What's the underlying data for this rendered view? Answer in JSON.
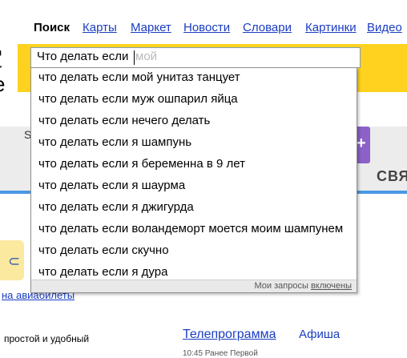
{
  "nav": {
    "items": [
      {
        "label": "Поиск",
        "active": true
      },
      {
        "label": "Карты"
      },
      {
        "label": "Маркет"
      },
      {
        "label": "Новости"
      },
      {
        "label": "Словари"
      },
      {
        "label": "Картинки"
      },
      {
        "label": "Видео"
      }
    ]
  },
  "logo": {
    "letter_c": "с",
    "letter_e": "е"
  },
  "search": {
    "typed_value": "Что делать если",
    "ghost_completion": "мой"
  },
  "suggestions": [
    "что делать если мой унитаз танцует",
    "что делать если муж ошпарил яйца",
    "что делать если нечего делать",
    "что делать если я шампунь",
    "что делать если я беременна в 9 лет",
    "что делать если я шаурма",
    "что делать если я джигурда",
    "что делать если воландеморт моется моим шампунем",
    "что делать если скучно",
    "что делать если я дура"
  ],
  "dropdown_footer": {
    "label": "Мои запросы",
    "link": "включены"
  },
  "background": {
    "ad_letter": "S",
    "ad_logo_text": "СВЯ",
    "avia_link": "на авиабилеты",
    "simple_text": "простой и удобный",
    "tv_link": "Телепрограмма",
    "afisha_link": "Афиша",
    "cut_row": "10:45 Ранее Первой"
  },
  "colors": {
    "link": "#1a3dc1",
    "search_band": "#ffd21f",
    "ghost_text": "#b9b9b9",
    "ad_accent": "#8c61c8",
    "divider_blue": "#4a96e3"
  }
}
